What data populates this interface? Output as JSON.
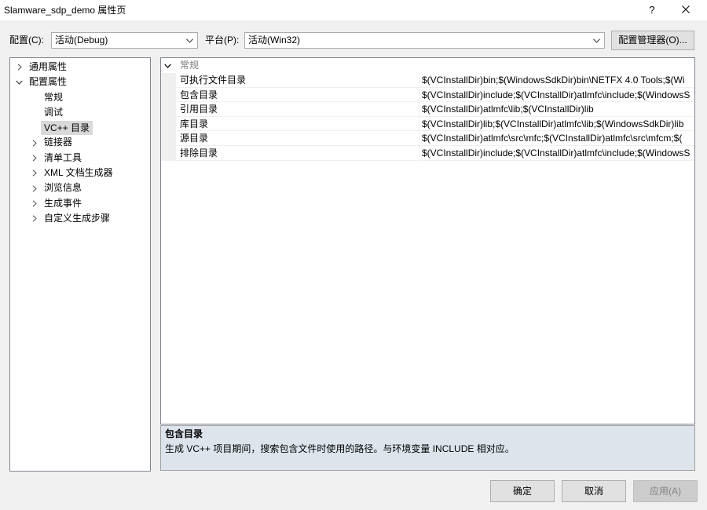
{
  "window": {
    "title": "Slamware_sdp_demo 属性页",
    "help_label": "?",
    "close_icon": "close-icon"
  },
  "config_bar": {
    "configuration_label": "配置(C):",
    "configuration_value": "活动(Debug)",
    "platform_label": "平台(P):",
    "platform_value": "活动(Win32)",
    "configuration_manager_button": "配置管理器(O)...",
    "dropdown_icon": "chevron-down-icon"
  },
  "tree": {
    "items": [
      {
        "label": "通用属性",
        "expanded": false,
        "icon": "chevron-right-icon"
      },
      {
        "label": "配置属性",
        "expanded": true,
        "icon": "chevron-down-icon",
        "children": [
          {
            "label": "常规"
          },
          {
            "label": "调试"
          },
          {
            "label": "VC++ 目录",
            "selected": true
          },
          {
            "label": "链接器",
            "expanded": false,
            "icon": "chevron-right-icon"
          },
          {
            "label": "清单工具",
            "expanded": false,
            "icon": "chevron-right-icon"
          },
          {
            "label": "XML 文档生成器",
            "expanded": false,
            "icon": "chevron-right-icon"
          },
          {
            "label": "浏览信息",
            "expanded": false,
            "icon": "chevron-right-icon"
          },
          {
            "label": "生成事件",
            "expanded": false,
            "icon": "chevron-right-icon"
          },
          {
            "label": "自定义生成步骤",
            "expanded": false,
            "icon": "chevron-right-icon"
          }
        ]
      }
    ]
  },
  "grid": {
    "category": {
      "label": "常规",
      "expanded": true,
      "icon": "chevron-down-icon"
    },
    "properties": [
      {
        "name": "可执行文件目录",
        "value": "$(VCInstallDir)bin;$(WindowsSdkDir)bin\\NETFX 4.0 Tools;$(Wi"
      },
      {
        "name": "包含目录",
        "value": "$(VCInstallDir)include;$(VCInstallDir)atlmfc\\include;$(WindowsS"
      },
      {
        "name": "引用目录",
        "value": "$(VCInstallDir)atlmfc\\lib;$(VCInstallDir)lib"
      },
      {
        "name": "库目录",
        "value": "$(VCInstallDir)lib;$(VCInstallDir)atlmfc\\lib;$(WindowsSdkDir)lib"
      },
      {
        "name": "源目录",
        "value": "$(VCInstallDir)atlmfc\\src\\mfc;$(VCInstallDir)atlmfc\\src\\mfcm;$("
      },
      {
        "name": "排除目录",
        "value": "$(VCInstallDir)include;$(VCInstallDir)atlmfc\\include;$(WindowsS"
      }
    ]
  },
  "description": {
    "title": "包含目录",
    "text": "生成 VC++ 项目期间，搜索包含文件时使用的路径。与环境变量 INCLUDE 相对应。"
  },
  "dialog_buttons": {
    "ok": "确定",
    "cancel": "取消",
    "apply": "应用(A)",
    "apply_enabled": false
  },
  "colors": {
    "dialog_background": "#f0f0f0",
    "tree_selection": "#d9d9d9",
    "description_background": "#dde4ec",
    "disabled_text": "#838383"
  }
}
